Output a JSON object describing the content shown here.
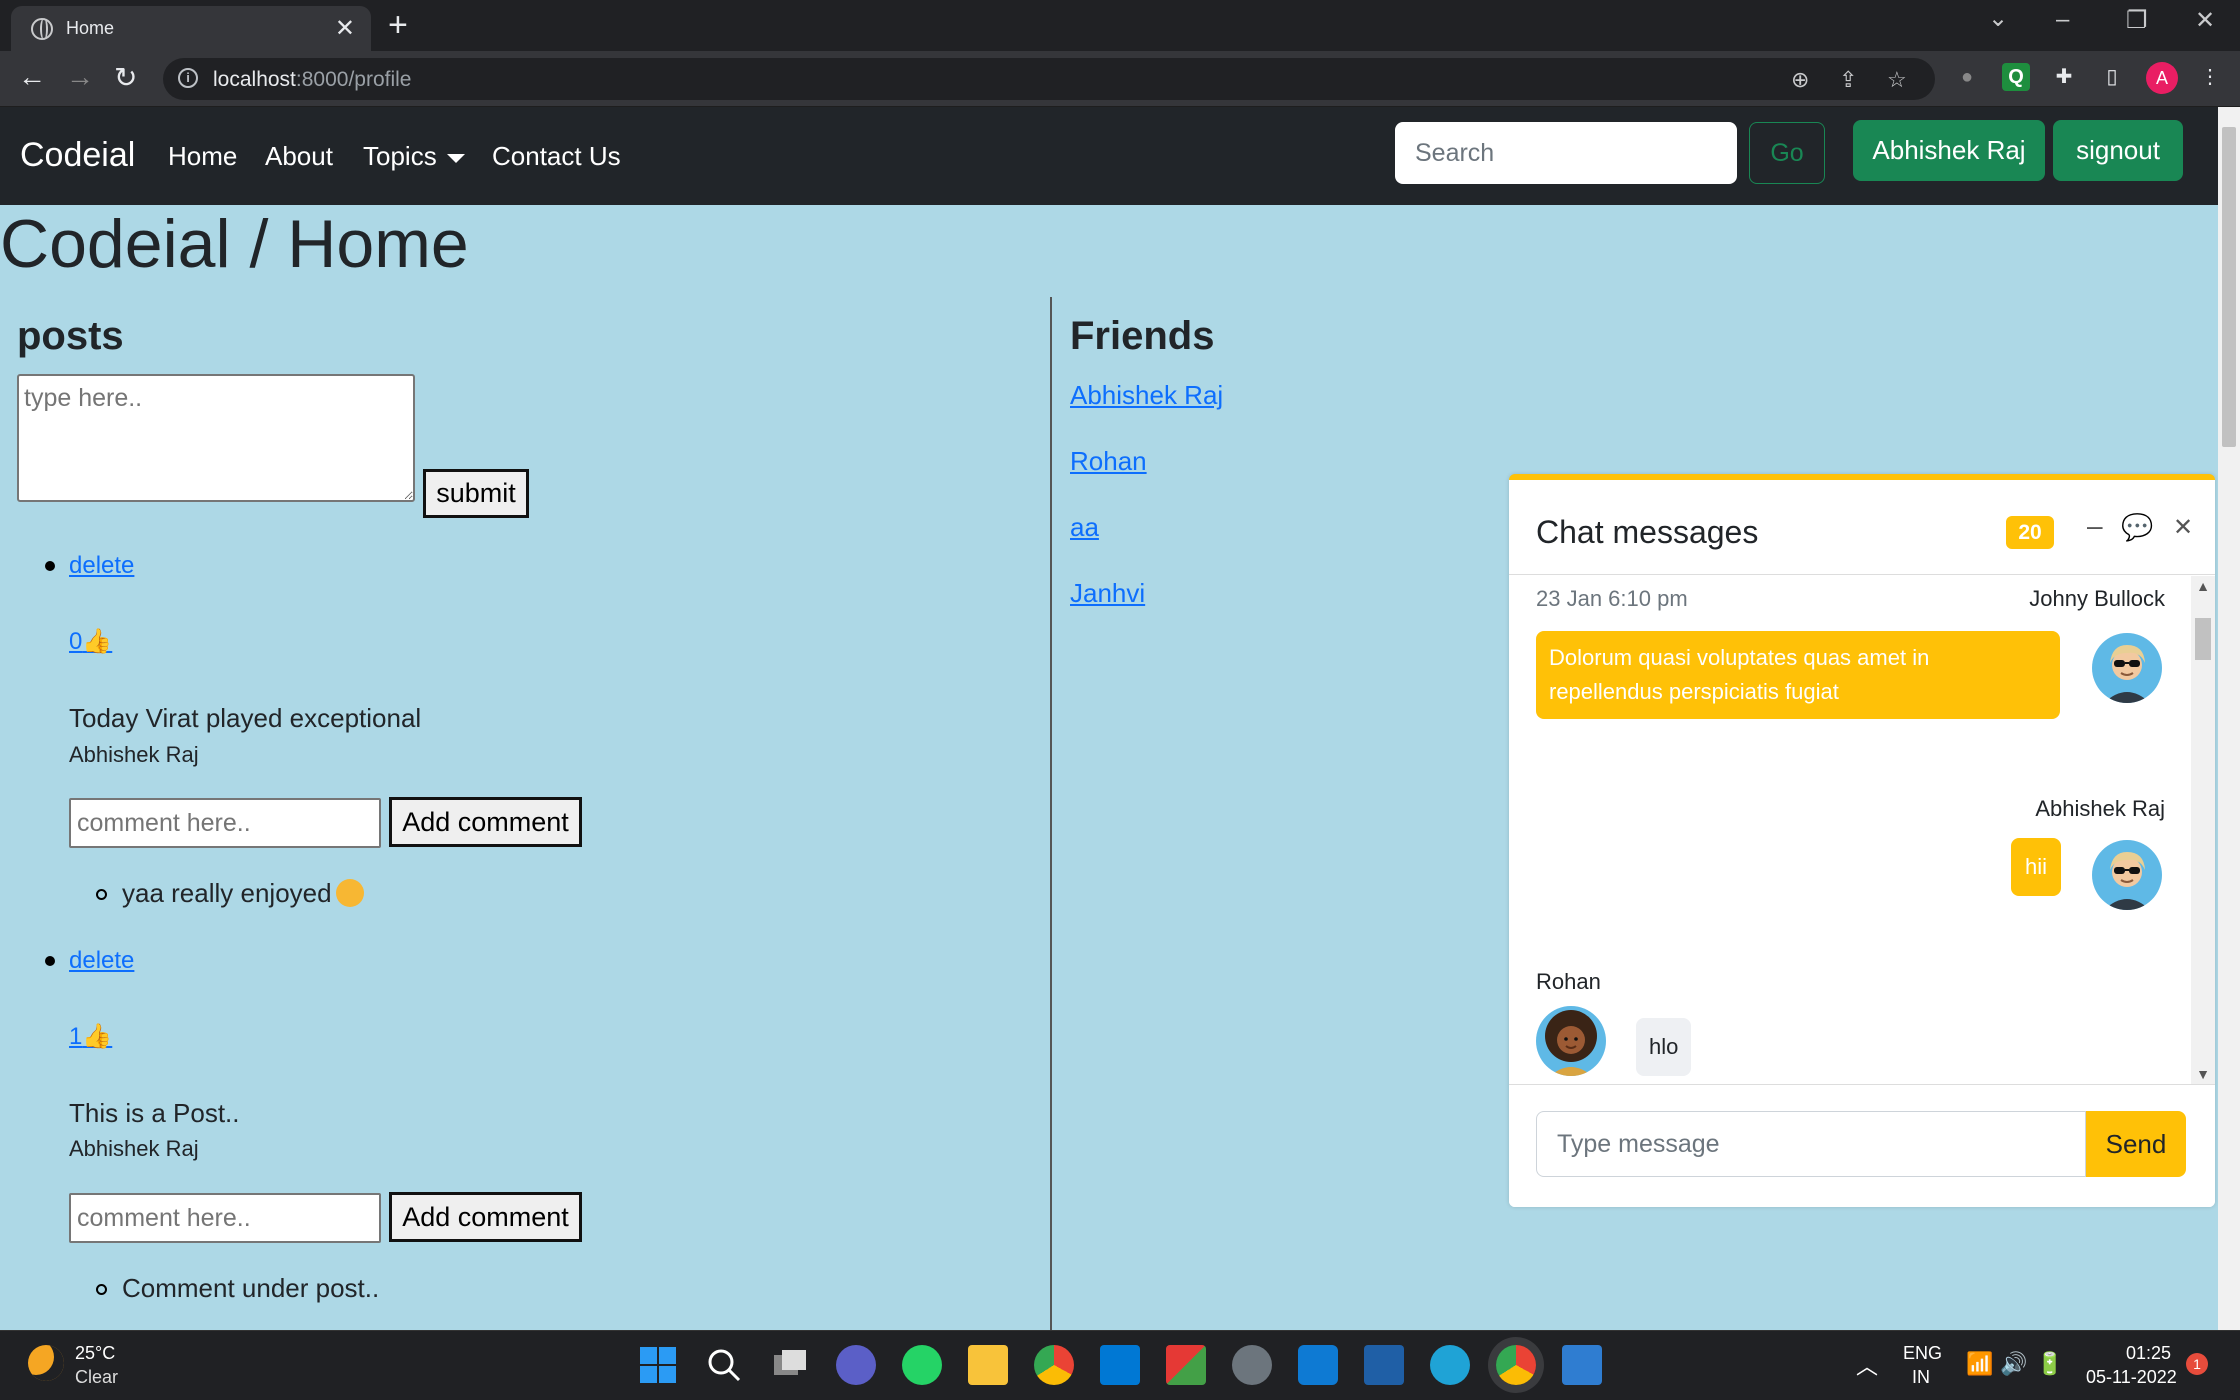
{
  "browser": {
    "tab_title": "Home",
    "url_host": "localhost",
    "url_path": ":8000/profile",
    "profile_initial": "A"
  },
  "navbar": {
    "brand": "Codeial",
    "links": [
      "Home",
      "About",
      "Topics",
      "Contact Us"
    ],
    "search_placeholder": "Search",
    "go_label": "Go",
    "user_button": "Abhishek Raj",
    "signout_button": "signout"
  },
  "page": {
    "title": "Codeial / Home"
  },
  "posts": {
    "heading": "posts",
    "textarea_placeholder": "type here..",
    "submit_label": "submit",
    "items": [
      {
        "delete_label": "delete",
        "likes": "0",
        "content": "Today Virat played exceptional",
        "author": "Abhishek Raj",
        "comment_placeholder": "comment here..",
        "add_comment_label": "Add comment",
        "comments": [
          "yaa really enjoyed"
        ]
      },
      {
        "delete_label": "delete",
        "likes": "1",
        "content": "This is a Post..",
        "author": "Abhishek Raj",
        "comment_placeholder": "comment here..",
        "add_comment_label": "Add comment",
        "comments": [
          "Comment under post.."
        ]
      }
    ]
  },
  "friends": {
    "heading": "Friends",
    "list": [
      "Abhishek Raj",
      "Rohan",
      "aa",
      "Janhvi"
    ]
  },
  "chat": {
    "title": "Chat messages",
    "badge": "20",
    "messages": [
      {
        "time": "23 Jan 6:10 pm",
        "sender": "Johny Bullock",
        "text": "Dolorum quasi voluptates quas amet in repellendus perspiciatis fugiat"
      },
      {
        "sender": "Abhishek Raj",
        "text": "hii"
      },
      {
        "sender": "Rohan",
        "text": "hlo"
      }
    ],
    "input_placeholder": "Type message",
    "send_label": "Send"
  },
  "taskbar": {
    "temperature": "25°C",
    "condition": "Clear",
    "language": "ENG",
    "region": "IN",
    "time": "01:25",
    "date": "05-11-2022",
    "notification_count": "1"
  },
  "colors": {
    "page_bg": "#add8e6",
    "navbar_bg": "#212529",
    "accent_green": "#198754",
    "chat_accent": "#ffc107",
    "link": "#0d6efd"
  }
}
